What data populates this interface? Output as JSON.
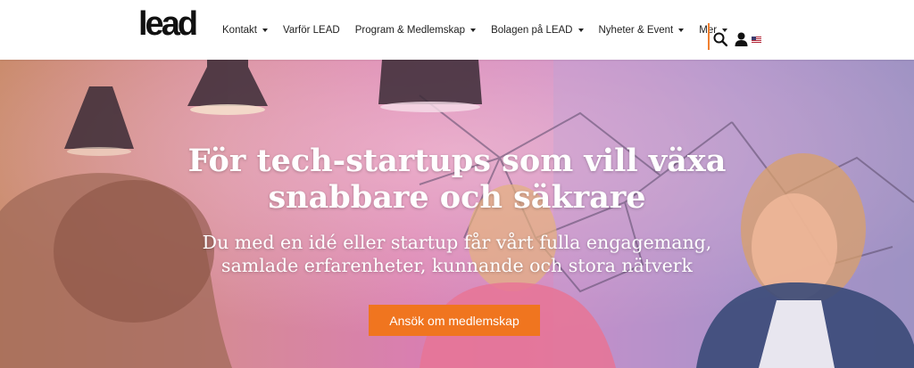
{
  "brand": {
    "logo_text": "lead"
  },
  "nav": {
    "items": [
      {
        "label": "Kontakt",
        "has_dropdown": true
      },
      {
        "label": "Varför LEAD",
        "has_dropdown": false
      },
      {
        "label": "Program & Medlemskap",
        "has_dropdown": true
      },
      {
        "label": "Bolagen på LEAD",
        "has_dropdown": true
      },
      {
        "label": "Nyheter & Event",
        "has_dropdown": true
      },
      {
        "label": "Mer",
        "has_dropdown": true
      }
    ],
    "icons": [
      "search-icon",
      "user-icon",
      "us-flag-icon"
    ]
  },
  "hero": {
    "title_line1": "För tech-startups som vill växa",
    "title_line2": "snabbare och säkrare",
    "subtitle_line1": "Du med en idé eller startup får vårt fulla engagemang,",
    "subtitle_line2": "samlade erfarenheter, kunnande och stora nätverk",
    "cta_label": "Ansök om medlemskap"
  },
  "colors": {
    "accent": "#f0751f",
    "divider": "#f08030",
    "text_dark": "#222222",
    "hero_text": "#ffffff"
  }
}
